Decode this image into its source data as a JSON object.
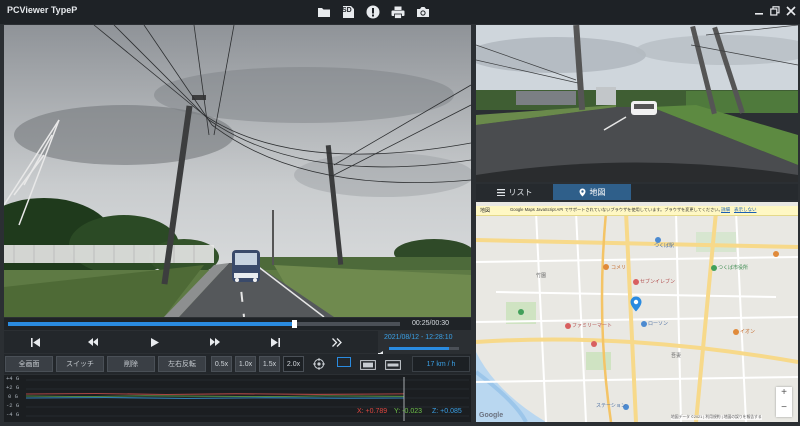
{
  "app": {
    "title": "PCViewer TypeP"
  },
  "toolbar": {
    "icons": [
      "folder-icon",
      "sd-card-icon",
      "alert-icon",
      "print-icon",
      "camera-icon"
    ],
    "sd_label": "SD"
  },
  "window_controls": [
    "minimize-icon",
    "restore-icon",
    "close-icon"
  ],
  "playback": {
    "progress": 0.73,
    "time": "00:25/00:30",
    "datetime": "2021/08/12 - 12:28:10",
    "volume": 0.85
  },
  "controls": {
    "functions": [
      "全画面",
      "スイッチ",
      "削除",
      "左右反転"
    ],
    "speeds": [
      "0.5x",
      "1.0x",
      "1.5x",
      "2.0x"
    ],
    "active_speed": "2.0x",
    "speed_readout": "17 km / h"
  },
  "gsensor": {
    "labels": [
      "+4 G",
      "+2 G",
      "0 G",
      "-2 G",
      "-4 G"
    ],
    "x": "X: +0.789",
    "y": "Y: -0.023",
    "z": "Z: +0.085",
    "colors": {
      "x": "#e0463f",
      "y": "#6fc24a",
      "z": "#3aa0e6"
    }
  },
  "side_tabs": {
    "list": "リスト",
    "map": "地図"
  },
  "map": {
    "notice": "Google Maps JavaScript API でサポートされていないブラウザを使用しています。ブラウザを変更してください。",
    "notice_link": "詳細",
    "notice_close": "表示しない",
    "corner_label": "地図",
    "google": "Google",
    "footer": "地図データ ©2021 | 利用規約 | 地図の誤りを報告する",
    "zoom_in": "+",
    "zoom_out": "−",
    "place_labels": [
      "つくば駅",
      "ローソン",
      "コメリ",
      "セブンイレブン",
      "ファミリーマート",
      "竹園",
      "吾妻",
      "つくば市役所",
      "イオン",
      "ステーション"
    ]
  },
  "colors": {
    "accent": "#2a8be0",
    "marker": "#2a8be0"
  }
}
